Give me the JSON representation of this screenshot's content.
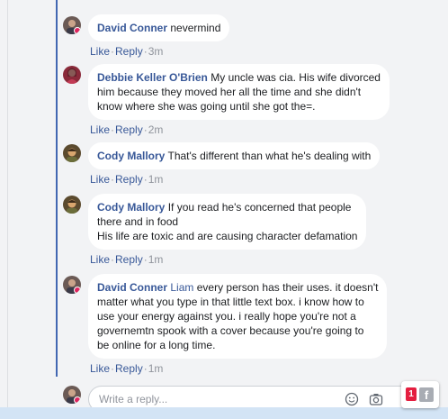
{
  "comments": [
    {
      "author": "David Conner",
      "mention": "",
      "lines": [
        "nevermind"
      ],
      "like": "Like",
      "reply": "Reply",
      "time": "3m"
    },
    {
      "author": "Debbie Keller O'Brien",
      "mention": "",
      "lines": [
        "My uncle was cia. His wife divorced",
        "him because they moved her all the time and she didn't",
        "know where she was going until she got the=."
      ],
      "like": "Like",
      "reply": "Reply",
      "time": "2m"
    },
    {
      "author": "Cody Mallory",
      "mention": "",
      "lines": [
        "That's different than what he's dealing with"
      ],
      "like": "Like",
      "reply": "Reply",
      "time": "1m"
    },
    {
      "author": "Cody Mallory",
      "mention": "",
      "lines": [
        "If you read he's concerned that people",
        "there and in food",
        "His life are toxic and are causing character defamation"
      ],
      "like": "Like",
      "reply": "Reply",
      "time": "1m"
    },
    {
      "author": "David Conner",
      "mention": "Liam",
      "lines": [
        "every person has their uses. it doesn't",
        "matter what you type in that little text box. i know how to",
        "use your energy against you. i really hope you're not a",
        "governemtn spook with a cover because you're going to",
        "be online for a long time."
      ],
      "like": "Like",
      "reply": "Reply",
      "time": "1m"
    }
  ],
  "reply_box": {
    "placeholder": "Write a reply...",
    "icons": [
      "emoji-icon",
      "camera-icon",
      "gif-icon",
      "sticker-icon"
    ]
  },
  "fb_widget": {
    "count": "1",
    "logo": "f"
  },
  "colors": {
    "author": "#385898",
    "thread_line": "#4267b2",
    "background": "#f2f3f5",
    "badge": "#e41e3f"
  }
}
